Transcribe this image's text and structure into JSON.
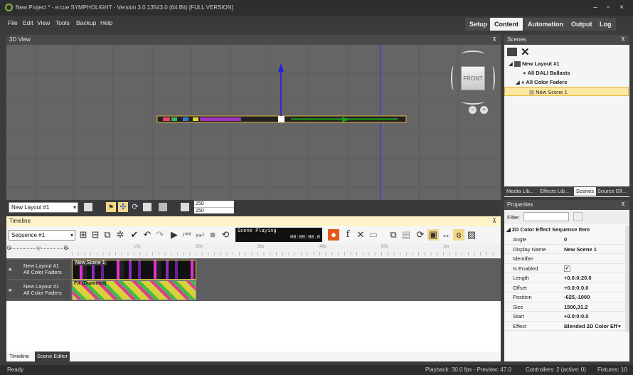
{
  "window": {
    "title": "New Project * - e:cue SYMPHOLIGHT - Version 3.0.13543.0 (64 Bit) [FULL VERSION]"
  },
  "menu": [
    "File",
    "Edit",
    "View",
    "Tools",
    "Backup",
    "Help"
  ],
  "top_tabs": [
    {
      "label": "Setup",
      "active": false
    },
    {
      "label": "Content",
      "active": true
    },
    {
      "label": "Automation",
      "active": false
    },
    {
      "label": "Output",
      "active": false
    },
    {
      "label": "Log",
      "active": false
    }
  ],
  "view3d": {
    "title": "3D View",
    "pin": "⊼",
    "cube_label": "FRONT"
  },
  "scenes": {
    "title": "Scenes",
    "pin": "⊼",
    "tree": [
      {
        "label": "New Layout #1"
      },
      {
        "label": "All DALI Ballasts"
      },
      {
        "label": "All Color Faders"
      },
      {
        "label": "New Scene 1",
        "selected": true
      }
    ],
    "lib_tabs": [
      "Media Lib...",
      "Effects Lib...",
      "Scenes",
      "Source Eff..."
    ],
    "active_lib_tab": "Scenes"
  },
  "layout_bar": {
    "layout": "New Layout #1",
    "value_a": "250",
    "value_b": "250"
  },
  "timeline": {
    "title": "Timeline",
    "pin": "⊼",
    "sequence": "Sequence #1",
    "playback_status": "Scene Playing",
    "playback_time": "00:00:00.0",
    "ruler": [
      "10s",
      "20s",
      "30s",
      "40s",
      "50s",
      "1m"
    ],
    "tracks": [
      {
        "line1": "New Layout #1",
        "line2": "All Color Faders",
        "clip": "New Scene 1"
      },
      {
        "line1": "New Layout #1",
        "line2": "All Color Faders",
        "clip": "FX (Diamond)"
      }
    ],
    "bottom_tabs": [
      "Timeline",
      "Scene Editor"
    ]
  },
  "properties": {
    "title": "Properties",
    "pin": "⊼",
    "filter_label": "Filter",
    "group": "2D Color Effect Sequence Item",
    "rows": [
      {
        "key": "Angle",
        "value": "0"
      },
      {
        "key": "Display Name",
        "value": "New Scene 1"
      },
      {
        "key": "Identifier",
        "value": ""
      },
      {
        "key": "Is Enabled",
        "value": "✓"
      },
      {
        "key": "Length",
        "value": "+0.0:0:20.0"
      },
      {
        "key": "Offset",
        "value": "+0.0:0:0.0"
      },
      {
        "key": "Position",
        "value": "-625,-1000"
      },
      {
        "key": "Size",
        "value": "1500,31.2"
      },
      {
        "key": "Start",
        "value": "+0.0:0:0.0"
      },
      {
        "key": "Effect",
        "value": "Blended 2D Color Eff"
      }
    ]
  },
  "status": {
    "left": "Ready",
    "playback": "Playback: 30.0 fps - Preview: 47.0",
    "controllers": "Controllers: 2 (active: 0)",
    "fixtures": "Fixtures: 10"
  }
}
